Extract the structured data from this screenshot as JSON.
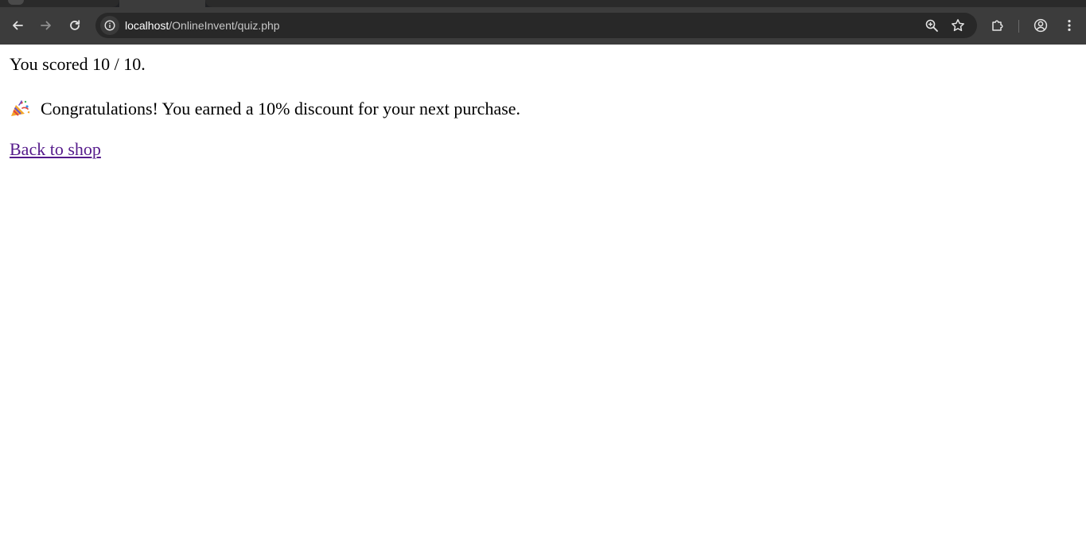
{
  "browser": {
    "url_host": "localhost",
    "url_path": "/OnlineInvent/quiz.php"
  },
  "page": {
    "score_text": "You scored 10 / 10.",
    "congrats_text": "Congratulations! You earned a 10% discount for your next purchase.",
    "back_link_text": "Back to shop",
    "link_color": "#551a8b"
  },
  "icons": {
    "back": "arrow-left-icon",
    "forward": "arrow-right-icon",
    "reload": "reload-icon",
    "site_info": "info-icon",
    "zoom": "zoom-icon",
    "bookmark": "star-icon",
    "extensions": "puzzle-icon",
    "profile": "profile-icon",
    "menu": "kebab-menu-icon",
    "celebration": "party-popper-icon"
  }
}
